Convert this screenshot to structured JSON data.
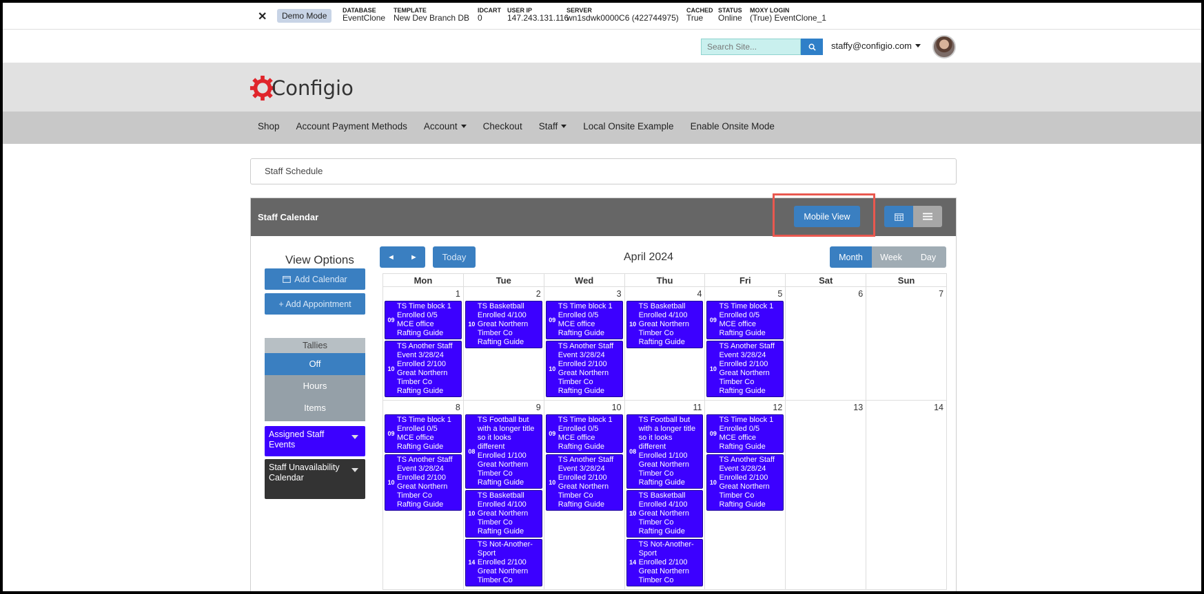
{
  "debug": {
    "close": "✕",
    "demo": "Demo Mode",
    "fields": [
      {
        "label": "DATABASE",
        "value": "EventClone"
      },
      {
        "label": "TEMPLATE",
        "value": "New Dev Branch DB"
      },
      {
        "label": "IDCART",
        "value": "0"
      },
      {
        "label": "USER IP",
        "value": "147.243.131.116"
      },
      {
        "label": "SERVER",
        "value": "wn1sdwk0000C6 (422744975)"
      },
      {
        "label": "CACHED",
        "value": "True"
      },
      {
        "label": "STATUS",
        "value": "Online"
      },
      {
        "label": "MOXY LOGIN",
        "value": "(True) EventClone_1"
      }
    ]
  },
  "search": {
    "placeholder": "Search Site..."
  },
  "user": {
    "email": "staffy@configio.com"
  },
  "brand": {
    "name": "Configio",
    "color": "#e0252b"
  },
  "nav": {
    "items": [
      {
        "label": "Shop",
        "dropdown": false
      },
      {
        "label": "Account Payment Methods",
        "dropdown": false
      },
      {
        "label": "Account",
        "dropdown": true
      },
      {
        "label": "Checkout",
        "dropdown": false
      },
      {
        "label": "Staff",
        "dropdown": true
      },
      {
        "label": "Local Onsite Example",
        "dropdown": false
      },
      {
        "label": "Enable Onsite Mode",
        "dropdown": false
      }
    ]
  },
  "breadcrumb": "Staff Schedule",
  "panel": {
    "title": "Staff Calendar",
    "mobile_view": "Mobile View"
  },
  "sidebar": {
    "title": "View Options",
    "add_calendar": "Add Calendar",
    "add_appointment": "+ Add Appointment",
    "tallies": {
      "label": "Tallies",
      "options": [
        "Off",
        "Hours",
        "Items"
      ],
      "active": "Off"
    },
    "filters": [
      {
        "label": "Assigned Staff Events",
        "color": "#3c00ff"
      },
      {
        "label": "Staff Unavailability Calendar",
        "color": "#333333"
      }
    ]
  },
  "calendar": {
    "title": "April 2024",
    "today": "Today",
    "prev": "◄",
    "next": "►",
    "modes": [
      "Month",
      "Week",
      "Day"
    ],
    "active_mode": "Month",
    "event_color": "#3c00ff",
    "days_of_week": [
      "Mon",
      "Tue",
      "Wed",
      "Thu",
      "Fri",
      "Sat",
      "Sun"
    ],
    "weeks": [
      [
        {
          "day": "1",
          "events": [
            {
              "time": "09",
              "text": "TS Time block 1\nEnrolled 0/5\nMCE office\nRafting Guide"
            },
            {
              "time": "10",
              "text": "TS Another Staff\nEvent 3/28/24\nEnrolled 2/100\nGreat Northern\nTimber Co\nRafting Guide"
            }
          ]
        },
        {
          "day": "2",
          "events": [
            {
              "time": "10",
              "text": "TS Basketball\nEnrolled 4/100\nGreat Northern\nTimber Co\nRafting Guide"
            }
          ]
        },
        {
          "day": "3",
          "events": [
            {
              "time": "09",
              "text": "TS Time block 1\nEnrolled 0/5\nMCE office\nRafting Guide"
            },
            {
              "time": "10",
              "text": "TS Another Staff\nEvent 3/28/24\nEnrolled 2/100\nGreat Northern\nTimber Co\nRafting Guide"
            }
          ]
        },
        {
          "day": "4",
          "events": [
            {
              "time": "10",
              "text": "TS Basketball\nEnrolled 4/100\nGreat Northern\nTimber Co\nRafting Guide"
            }
          ]
        },
        {
          "day": "5",
          "events": [
            {
              "time": "09",
              "text": "TS Time block 1\nEnrolled 0/5\nMCE office\nRafting Guide"
            },
            {
              "time": "10",
              "text": "TS Another Staff\nEvent 3/28/24\nEnrolled 2/100\nGreat Northern\nTimber Co\nRafting Guide"
            }
          ]
        },
        {
          "day": "6",
          "events": []
        },
        {
          "day": "7",
          "events": []
        }
      ],
      [
        {
          "day": "8",
          "events": [
            {
              "time": "09",
              "text": "TS Time block 1\nEnrolled 0/5\nMCE office\nRafting Guide"
            },
            {
              "time": "10",
              "text": "TS Another Staff\nEvent 3/28/24\nEnrolled 2/100\nGreat Northern\nTimber Co\nRafting Guide"
            }
          ]
        },
        {
          "day": "9",
          "events": [
            {
              "time": "08",
              "text": "TS Football but\nwith a longer title\nso it looks\ndifferent\nEnrolled 1/100\nGreat Northern\nTimber Co\nRafting Guide"
            },
            {
              "time": "10",
              "text": "TS Basketball\nEnrolled 4/100\nGreat Northern\nTimber Co\nRafting Guide"
            },
            {
              "time": "14",
              "text": "TS Not-Another-\nSport\nEnrolled 2/100\nGreat Northern\nTimber Co"
            }
          ]
        },
        {
          "day": "10",
          "events": [
            {
              "time": "09",
              "text": "TS Time block 1\nEnrolled 0/5\nMCE office\nRafting Guide"
            },
            {
              "time": "10",
              "text": "TS Another Staff\nEvent 3/28/24\nEnrolled 2/100\nGreat Northern\nTimber Co\nRafting Guide"
            }
          ]
        },
        {
          "day": "11",
          "events": [
            {
              "time": "08",
              "text": "TS Football but\nwith a longer title\nso it looks\ndifferent\nEnrolled 1/100\nGreat Northern\nTimber Co\nRafting Guide"
            },
            {
              "time": "10",
              "text": "TS Basketball\nEnrolled 4/100\nGreat Northern\nTimber Co\nRafting Guide"
            },
            {
              "time": "14",
              "text": "TS Not-Another-\nSport\nEnrolled 2/100\nGreat Northern\nTimber Co"
            }
          ]
        },
        {
          "day": "12",
          "events": [
            {
              "time": "09",
              "text": "TS Time block 1\nEnrolled 0/5\nMCE office\nRafting Guide"
            },
            {
              "time": "10",
              "text": "TS Another Staff\nEvent 3/28/24\nEnrolled 2/100\nGreat Northern\nTimber Co\nRafting Guide"
            }
          ]
        },
        {
          "day": "13",
          "events": []
        },
        {
          "day": "14",
          "events": []
        }
      ]
    ]
  }
}
